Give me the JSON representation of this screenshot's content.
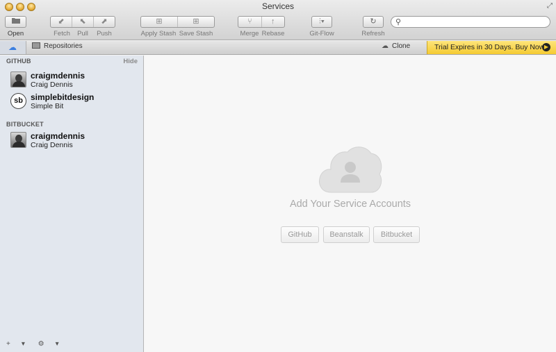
{
  "window": {
    "title": "Services"
  },
  "toolbar": {
    "open_label": "Open",
    "fetch_label": "Fetch",
    "pull_label": "Pull",
    "push_label": "Push",
    "apply_stash_label": "Apply Stash",
    "save_stash_label": "Save Stash",
    "merge_label": "Merge",
    "rebase_label": "Rebase",
    "gitflow_label": "Git-Flow",
    "refresh_label": "Refresh",
    "search": {
      "value": "",
      "placeholder": ""
    }
  },
  "tabbar": {
    "repositories_label": "Repositories",
    "clone_label": "Clone",
    "trial_text": "Trial Expires in 30 Days. Buy Now!"
  },
  "sidebar": {
    "github_header": "GITHUB",
    "hide_label": "Hide",
    "github_accounts": [
      {
        "username": "craigmdennis",
        "full_name": "Craig Dennis",
        "avatar": "photo"
      },
      {
        "username": "simplebitdesign",
        "full_name": "Simple Bit",
        "avatar": "sb",
        "avatar_text": "sb"
      }
    ],
    "bitbucket_header": "BITBUCKET",
    "bitbucket_accounts": [
      {
        "username": "craigmdennis",
        "full_name": "Craig Dennis",
        "avatar": "photo"
      }
    ],
    "add_label": "+",
    "settings_label": "⚙"
  },
  "main": {
    "empty_title": "Add Your Service Accounts",
    "buttons": {
      "github": "GitHub",
      "beanstalk": "Beanstalk",
      "bitbucket": "Bitbucket"
    }
  },
  "colors": {
    "trial_bg": "#f5cb32",
    "sidebar_bg": "#e2e7ee",
    "cloud_icon": "#3b7fe0"
  }
}
